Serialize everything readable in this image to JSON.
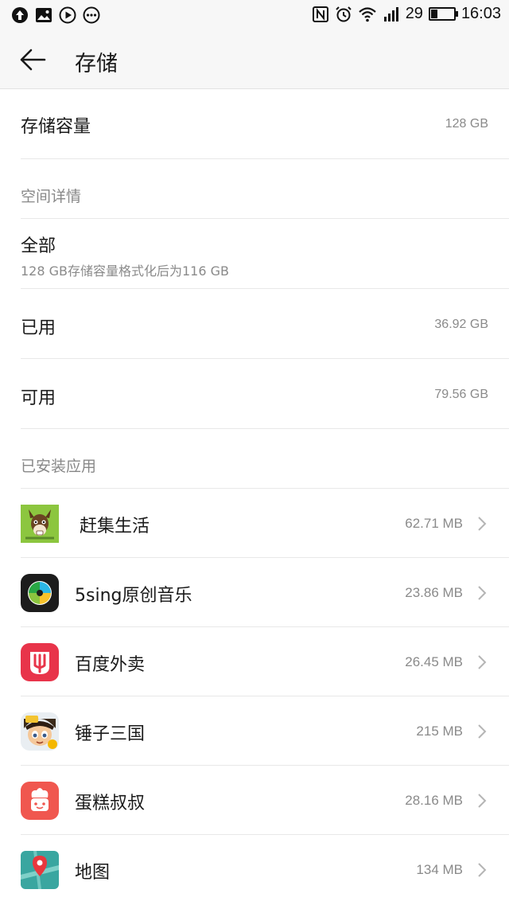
{
  "status_bar": {
    "battery_level": "29",
    "battery_fraction": 0.29,
    "time": "16:03",
    "left_icons": [
      "upload-arrow-icon",
      "image-icon",
      "play-icon",
      "more-dots-icon"
    ],
    "right_icons": [
      "nfc-icon",
      "alarm-icon",
      "wifi-icon",
      "signal-icon",
      "battery-icon"
    ]
  },
  "header": {
    "back_icon": "back-arrow-icon",
    "title": "存储"
  },
  "storage_capacity": {
    "label": "存储容量",
    "value": "128 GB"
  },
  "space_details": {
    "section_title": "空间详情",
    "total": {
      "label": "全部",
      "subtitle": "128 GB存储容量格式化后为116 GB"
    },
    "used": {
      "label": "已用",
      "value": "36.92 GB"
    },
    "available": {
      "label": "可用",
      "value": "79.56 GB"
    }
  },
  "installed_apps": {
    "section_title": "已安装应用",
    "items": [
      {
        "name": "赶集生活",
        "size": "62.71 MB",
        "icon": "donkey-icon"
      },
      {
        "name": "5sing原创音乐",
        "size": "23.86 MB",
        "icon": "leaf-music-icon"
      },
      {
        "name": "百度外卖",
        "size": "26.45 MB",
        "icon": "fork-bag-icon"
      },
      {
        "name": "锤子三国",
        "size": "215 MB",
        "icon": "warrior-icon"
      },
      {
        "name": "蛋糕叔叔",
        "size": "28.16 MB",
        "icon": "chef-cake-icon"
      },
      {
        "name": "地图",
        "size": "134 MB",
        "icon": "map-pin-icon"
      }
    ]
  },
  "colors": {
    "background": "#ffffff",
    "header_background": "#f7f7f7",
    "secondary_text": "#8a8a8a",
    "divider": "#e8e8e8"
  }
}
